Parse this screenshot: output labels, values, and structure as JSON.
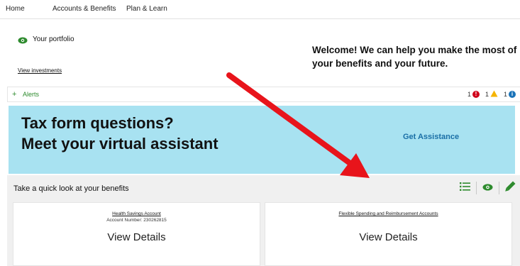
{
  "topnav": {
    "items": [
      {
        "label": "Home"
      },
      {
        "label": "Accounts & Benefits"
      },
      {
        "label": "Plan & Learn"
      }
    ]
  },
  "portfolio": {
    "label": "Your portfolio",
    "view_investments": "View investments",
    "welcome": "Welcome! We can help you make the most of your benefits and your future."
  },
  "alerts": {
    "plus": "+",
    "label": "Alerts",
    "counts": [
      {
        "value": "1",
        "kind": "error",
        "color": "#d0021b",
        "glyph": "!"
      },
      {
        "value": "1",
        "kind": "warning",
        "color": "#f5b400",
        "glyph": "!"
      },
      {
        "value": "1",
        "kind": "info",
        "color": "#1a73b8",
        "glyph": "i"
      }
    ]
  },
  "banner": {
    "line1": "Tax form questions?",
    "line2": "Meet your virtual assistant",
    "cta": "Get Assistance",
    "background": "#a8e2f1"
  },
  "benefits": {
    "heading": "Take a quick look at your benefits",
    "cards": [
      {
        "title": "Health Savings Account",
        "subtitle": "Account Number: 230262815",
        "cta": "View Details"
      },
      {
        "title": "Flexible Spending and Reimbursement Accounts",
        "subtitle": "",
        "cta": "View Details"
      }
    ],
    "icons": [
      "list-view-icon",
      "eye-icon",
      "pencil-icon"
    ]
  },
  "accent_green": "#2e8b2e",
  "annotation_arrow_color": "#e8141b"
}
